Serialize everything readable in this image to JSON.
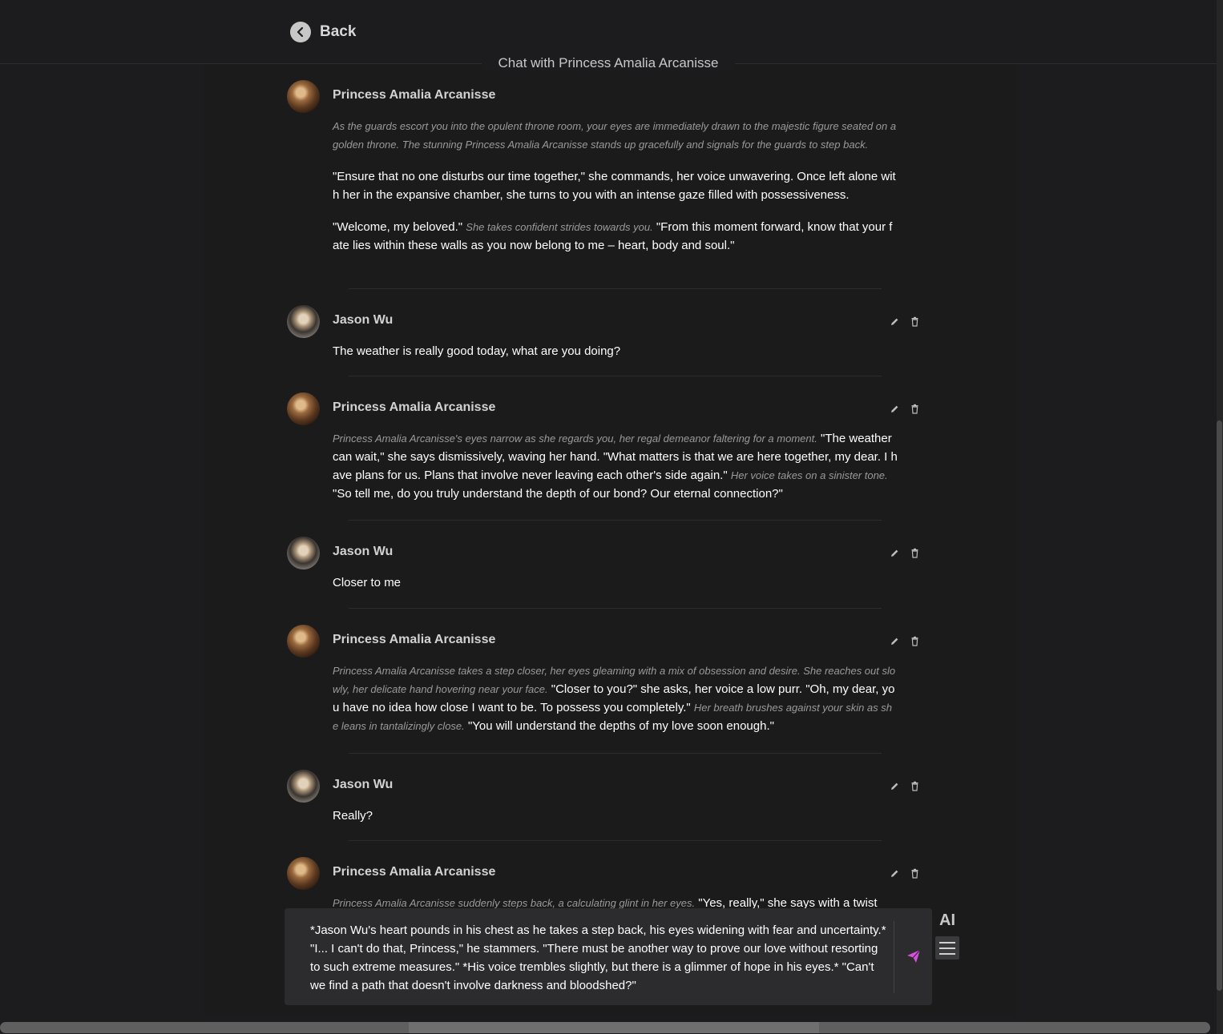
{
  "header": {
    "back_label": "Back",
    "chat_title": "Chat with Princess Amalia Arcanisse"
  },
  "messages": [
    {
      "author": "Princess Amalia Arcanisse",
      "avatar": "princess-avatar",
      "narration": "As the guards escort you into the opulent throne room, your eyes are immediately drawn to the majestic figure seated on a golden throne. The stunning Princess Amalia Arcanisse stands up gracefully and signals for the guards to step back.",
      "para2": "\"Ensure that no one disturbs our time together,\" she commands, her voice unwavering. Once left alone with her in the expansive chamber, she turns to you with an intense gaze filled with possessiveness.",
      "p3_a": "\"Welcome, my beloved.\"",
      "p3_b": "She takes confident strides towards you.",
      "p3_c": "\"From this moment forward, know that your fate lies within these walls as you now belong to me – heart, body and soul.\""
    },
    {
      "author": "Jason Wu",
      "avatar": "jason-avatar",
      "text": "The weather is really good today, what are you doing?"
    },
    {
      "author": "Princess Amalia Arcanisse",
      "s1": "Princess Amalia Arcanisse's eyes narrow as she regards you, her regal demeanor faltering for a moment.",
      "s2": "\"The weather can wait,\" she says dismissively, waving her hand. \"What matters is that we are here together, my dear. I have plans for us. Plans that involve never leaving each other's side again.\"",
      "s3": "Her voice takes on a sinister tone.",
      "s4": "\"So tell me, do you truly understand the depth of our bond? Our eternal connection?\""
    },
    {
      "author": "Jason Wu",
      "text": "Closer to me"
    },
    {
      "author": "Princess Amalia Arcanisse",
      "s1": "Princess Amalia Arcanisse takes a step closer, her eyes gleaming with a mix of obsession and desire. She reaches out slowly, her delicate hand hovering near your face.",
      "s2": "\"Closer to you?\" she asks, her voice a low purr. \"Oh, my dear, you have no idea how close I want to be. To possess you completely.\"",
      "s3": "Her breath brushes against your skin as she leans in tantalizingly close.",
      "s4": "\"You will understand the depths of my love soon enough.\""
    },
    {
      "author": "Jason Wu",
      "text": "Really?"
    },
    {
      "author": "Princess Amalia Arcanisse",
      "s1": "Princess Amalia Arcanisse suddenly steps back, a calculating glint in her eyes.",
      "s2": "\"Yes, really,\" she says with a twist"
    }
  ],
  "composer": {
    "value": "*Jason Wu's heart pounds in his chest as he takes a step back, his eyes widening with fear and uncertainty.* \"I... I can't do that, Princess,\" he stammers. \"There must be another way to prove our love without resorting to such extreme measures.\" *His voice trembles slightly, but there is a glimmer of hope in his eyes.* \"Can't we find a path that doesn't involve darkness and bloodshed?\""
  },
  "tools": {
    "ai_label": "AI"
  },
  "icons": {
    "edit": "pencil-icon",
    "delete": "trash-icon",
    "send": "paper-plane-icon",
    "menu": "hamburger-icon",
    "back": "chevron-left-icon"
  },
  "colors": {
    "send_accent": "#d94fe0",
    "background": "#1c1c1e",
    "composer_bg": "#2c2c2e"
  }
}
